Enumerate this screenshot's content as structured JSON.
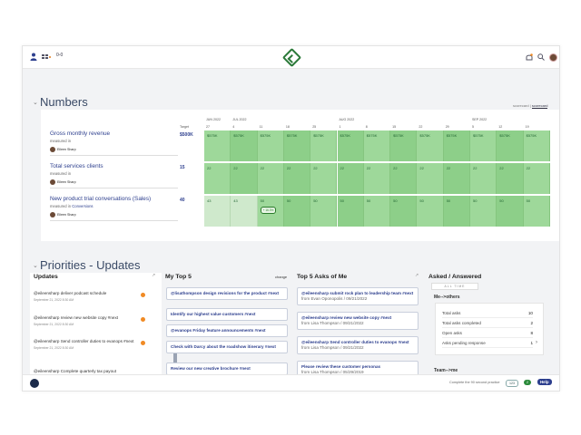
{
  "header": {
    "user_icon": "person-icon",
    "apps_icon": "apps-icon",
    "nav_glyph": "0-0",
    "notification_icon": "bell-icon",
    "search_icon": "search-icon"
  },
  "numbers": {
    "title": "Numbers",
    "toggle_left": "scorecard",
    "toggle_sep": "|",
    "toggle_right": "scorecard",
    "target_label": "Target",
    "months": [
      "JUN 2022",
      "JUL 2022",
      "AUG 2022",
      "SEP 2022"
    ],
    "days": [
      "27",
      "4",
      "11",
      "18",
      "25",
      "1",
      "8",
      "15",
      "22",
      "29",
      "5",
      "12",
      "19"
    ],
    "metrics": [
      {
        "name": "Gross monthly revenue",
        "measured_prefix": "measured in",
        "measured_unit": "",
        "owner": "Eileen Sharp",
        "target": "$500K",
        "values": [
          "$575K",
          "$575K",
          "$575K",
          "$575K",
          "$575K",
          "$575K",
          "$575K",
          "$575K",
          "$575K",
          "$575K",
          "$575K",
          "$575K",
          "$575K"
        ]
      },
      {
        "name": "Total services clients",
        "measured_prefix": "measured in",
        "measured_unit": "",
        "owner": "Eileen Sharp",
        "target": "15",
        "values": [
          "22",
          "22",
          "22",
          "22",
          "22",
          "22",
          "22",
          "22",
          "22",
          "22",
          "22",
          "22",
          "22"
        ]
      },
      {
        "name": "New product trial conversations (Sales)",
        "measured_prefix": "measured in",
        "measured_unit": "Conversions",
        "owner": "Eileen Sharp",
        "target": "40",
        "values": [
          "43",
          "43",
          "50",
          "50",
          "50",
          "50",
          "50",
          "50",
          "50",
          "50",
          "50",
          "50",
          "50"
        ],
        "badge": "+ 16.3%"
      }
    ]
  },
  "priorities": {
    "title": "Priorities - Updates",
    "updates": {
      "title": "Updates",
      "items": [
        {
          "text": "@eileensharp deliver podcast schedule",
          "time": "September 21, 2022 8:30 AM"
        },
        {
          "text": "@eileensharp review new website copy #next",
          "time": "September 21, 2022 8:30 AM"
        },
        {
          "text": "@eileensharp Send controller duties to evanops #next",
          "time": "September 21, 2022 8:30 AM"
        },
        {
          "text": "@eileensharp Complete quarterly tax payout",
          "time": ""
        }
      ]
    },
    "my_top5": {
      "title": "My Top 5",
      "change_label": "change",
      "items": [
        "@lisathompson design revisions for the product #next",
        "Identify our highest value customers #next",
        "@evanops Friday feature announcements #next",
        "Check with Darcy about the roadshow itinerary #next",
        "Review our new creative brochure #next"
      ]
    },
    "asks": {
      "title": "Top 5 Asks of Me",
      "items": [
        {
          "text": "@eileensharp submit rock plan to leadership team #next",
          "from": "from Evan Oponopolis / 09/21/2022"
        },
        {
          "text": "@eileensharp review new website copy #next",
          "from": "from Lisa Thompson / 09/21/2022"
        },
        {
          "text": "@eileensharp Send controller duties to evanops #next",
          "from": "from Lisa Thompson / 09/21/2022"
        },
        {
          "text": "Please review these customer personas",
          "from": "from Lisa Thompson / 05/29/2019"
        }
      ]
    },
    "answered": {
      "title": "Asked / Answered",
      "filter": "ALL TIME",
      "me_others": "Me-->others",
      "rows": [
        {
          "label": "Total asks",
          "value": "10"
        },
        {
          "label": "Total asks completed",
          "value": "2"
        },
        {
          "label": "Open asks",
          "value": "8"
        },
        {
          "label": "Asks pending response",
          "value": "1"
        }
      ],
      "team_me": "Team-->me"
    }
  },
  "footer": {
    "practice_text": "Complete the 90 second practice",
    "count_a": "123",
    "count_b": "2",
    "help_label": "Help"
  }
}
